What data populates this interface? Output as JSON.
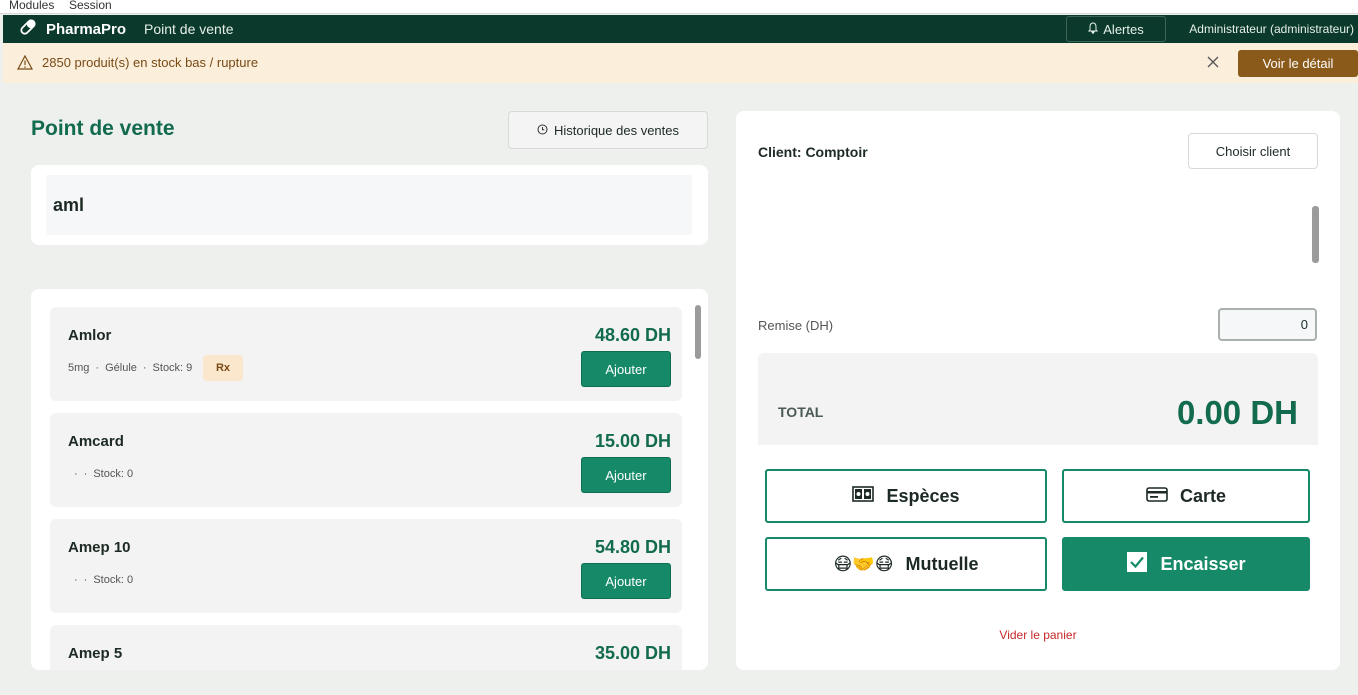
{
  "menubar": {
    "modules": "Modules",
    "session": "Session"
  },
  "topbar": {
    "brand": "PharmaPro",
    "breadcrumb": "Point de vente",
    "alerts_label": "Alertes",
    "user": "Administrateur (administrateur)"
  },
  "banner": {
    "message": "2850 produit(s) en stock bas / rupture",
    "action_label": "Voir le détail"
  },
  "pos": {
    "title": "Point de vente",
    "history_label": "Historique des ventes",
    "search_value": "aml"
  },
  "products": [
    {
      "name": "Amlor",
      "dosage": "5mg",
      "form": "Gélule",
      "stock": "Stock: 9",
      "badge": "Rx",
      "price": "48.60 DH",
      "add_label": "Ajouter"
    },
    {
      "name": "Amcard",
      "dosage": "",
      "form": "",
      "stock": "Stock: 0",
      "badge": "",
      "price": "15.00 DH",
      "add_label": "Ajouter"
    },
    {
      "name": "Amep 10",
      "dosage": "",
      "form": "",
      "stock": "Stock: 0",
      "badge": "",
      "price": "54.80 DH",
      "add_label": "Ajouter"
    },
    {
      "name": "Amep 5",
      "dosage": "",
      "form": "",
      "stock": "",
      "badge": "",
      "price": "35.00 DH",
      "add_label": ""
    }
  ],
  "cart": {
    "client_label": "Client: Comptoir",
    "choose_client_label": "Choisir client",
    "discount_label": "Remise (DH)",
    "discount_value": "0",
    "total_label": "TOTAL",
    "total_value": "0.00 DH",
    "cash_label": "Espèces",
    "card_label": "Carte",
    "mutual_label": "Mutuelle",
    "checkout_label": "Encaisser",
    "empty_cart_label": "Vider le panier",
    "mutual_icons": "😷🤝😷"
  },
  "colors": {
    "topbar": "#0b3a2c",
    "brand_green": "#126b4f",
    "button_green": "#168a68",
    "banner_bg": "#fbefdc",
    "banner_button": "#8a5a1a",
    "danger": "#c62828"
  }
}
